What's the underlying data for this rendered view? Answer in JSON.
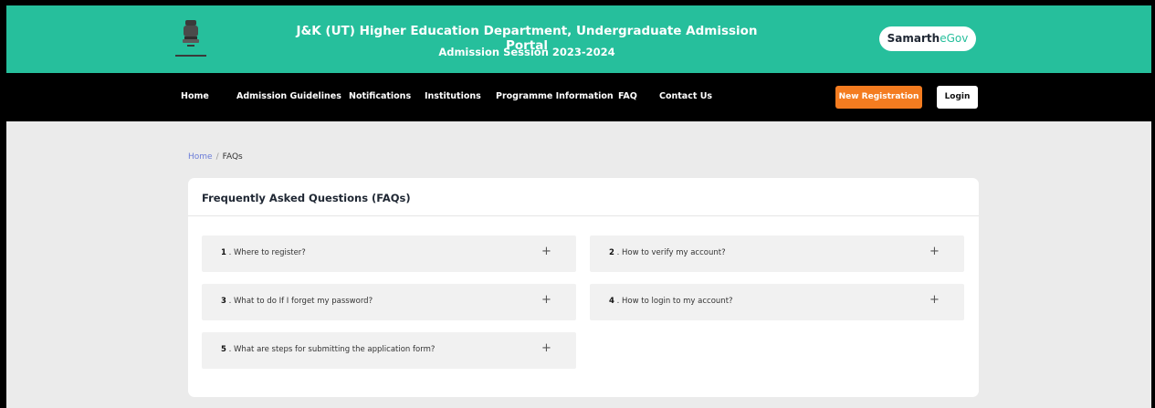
{
  "header": {
    "title": "J&K (UT) Higher Education Department, Undergraduate Admission Portal",
    "subtitle": "Admission Session 2023-2024",
    "brand_badge": {
      "part1": "Samarth",
      "part2": "eGov"
    },
    "brand_color": "#26bf9c",
    "emblem_icon": "national-emblem-icon"
  },
  "nav": {
    "links": [
      "Home",
      "Admission Guidelines",
      "Notifications",
      "Institutions",
      "Programme Information",
      "FAQ",
      "Contact Us"
    ],
    "new_registration_label": "New Registration",
    "login_label": "Login",
    "accent_color": "#f47c20"
  },
  "breadcrumb": {
    "home": "Home",
    "separator": "/",
    "current": "FAQs"
  },
  "faq_card": {
    "title": "Frequently Asked Questions (FAQs)",
    "items": [
      {
        "num": "1",
        "question": "Where to register?"
      },
      {
        "num": "2",
        "question": "How to verify my account?"
      },
      {
        "num": "3",
        "question": "What to do If I forget my password?"
      },
      {
        "num": "4",
        "question": "How to login to my account?"
      },
      {
        "num": "5",
        "question": "What are steps for submitting the application form?"
      }
    ],
    "expand_icon": "+"
  }
}
